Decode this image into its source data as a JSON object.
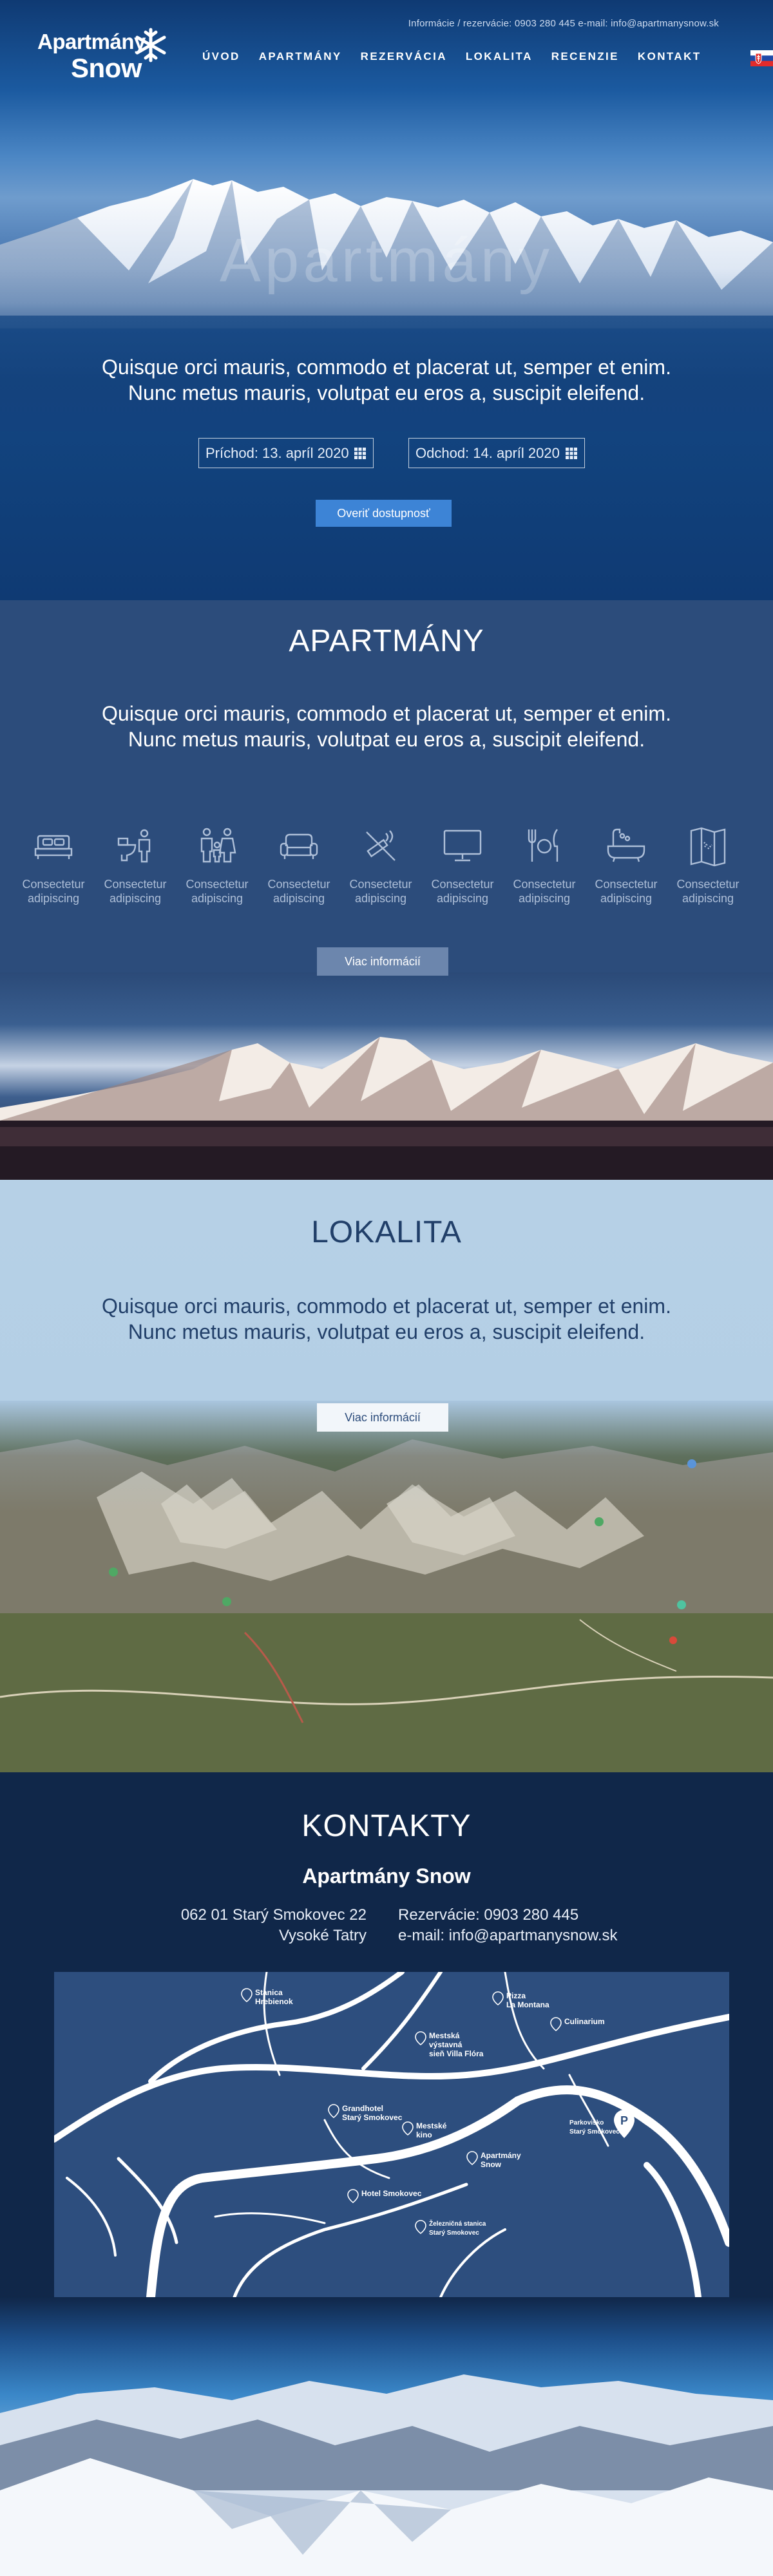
{
  "header": {
    "topinfo": "Informácie / rezervácie: 0903 280 445 e-mail: info@apartmanysnow.sk",
    "logo_line1": "Apartmány",
    "logo_line2": "Snow",
    "nav": [
      "ÚVOD",
      "APARTMÁNY",
      "REZERVÁCIA",
      "LOKALITA",
      "RECENZIE",
      "KONTAKT"
    ],
    "flag": "flag-slovakia-icon"
  },
  "hero": {
    "title": "Apartmány",
    "text_line1": "Quisque orci mauris, commodo et placerat ut, semper et enim.",
    "text_line2": "Nunc metus mauris, volutpat eu eros a, suscipit eleifend.",
    "arrival": "Príchod: 13. apríl 2020",
    "departure": "Odchod: 14. apríl 2020",
    "check_button": "Overiť dostupnosť"
  },
  "apartments": {
    "title": "APARTMÁNY",
    "text_line1": "Quisque orci mauris, commodo et placerat ut, semper et enim.",
    "text_line2": "Nunc metus mauris, volutpat eu eros a, suscipit eleifend.",
    "amenities": [
      {
        "icon": "bed-icon",
        "line1": "Consectetur",
        "line2": "adipiscing"
      },
      {
        "icon": "wc-icon",
        "line1": "Consectetur",
        "line2": "adipiscing"
      },
      {
        "icon": "family-icon",
        "line1": "Consectetur",
        "line2": "adipiscing"
      },
      {
        "icon": "sofa-icon",
        "line1": "Consectetur",
        "line2": "adipiscing"
      },
      {
        "icon": "no-smoking-icon",
        "line1": "Consectetur",
        "line2": "adipiscing"
      },
      {
        "icon": "tv-icon",
        "line1": "Consectetur",
        "line2": "adipiscing"
      },
      {
        "icon": "dining-icon",
        "line1": "Consectetur",
        "line2": "adipiscing"
      },
      {
        "icon": "bathtub-icon",
        "line1": "Consectetur",
        "line2": "adipiscing"
      },
      {
        "icon": "map-icon",
        "line1": "Consectetur",
        "line2": "adipiscing"
      }
    ],
    "more_button": "Viac informácií"
  },
  "location": {
    "title": "LOKALITA",
    "text_line1": "Quisque orci mauris, commodo et placerat ut, semper et enim.",
    "text_line2": "Nunc metus mauris, volutpat eu eros a, suscipit eleifend.",
    "more_button": "Viac informácií"
  },
  "contacts": {
    "title": "KONTAKTY",
    "name": "Apartmány Snow",
    "address_line1": "062 01 Starý Smokovec 22",
    "address_line2": "Vysoké Tatry",
    "phone": "Rezervácie: 0903 280 445",
    "email": "e-mail: info@apartmanysnow.sk",
    "map_pois": [
      {
        "line1": "Stanica",
        "line2": "Hrebienok"
      },
      {
        "line1": "Pizza",
        "line2": "La Montana"
      },
      {
        "line1": "Culinarium",
        "line2": ""
      },
      {
        "line1": "Mestská",
        "line2": "výstavná"
      },
      {
        "line1": "sieň Villa Flóra",
        "line2": ""
      },
      {
        "line1": "Grandhotel",
        "line2": "Starý Smokovec"
      },
      {
        "line1": "Mestské",
        "line2": "kino"
      },
      {
        "line1": "Parkovisko",
        "line2": "Starý Smokovec"
      },
      {
        "line1": "Apartmány",
        "line2": "Snow"
      },
      {
        "line1": "Hotel Smokovec",
        "line2": ""
      },
      {
        "line1": "Železničná stanica",
        "line2": "Starý Smokovec"
      }
    ]
  },
  "colors": {
    "accent": "#3d84d6",
    "dark": "#102749",
    "section_blue": "#2c4c7b",
    "light": "#b6d0e6"
  }
}
